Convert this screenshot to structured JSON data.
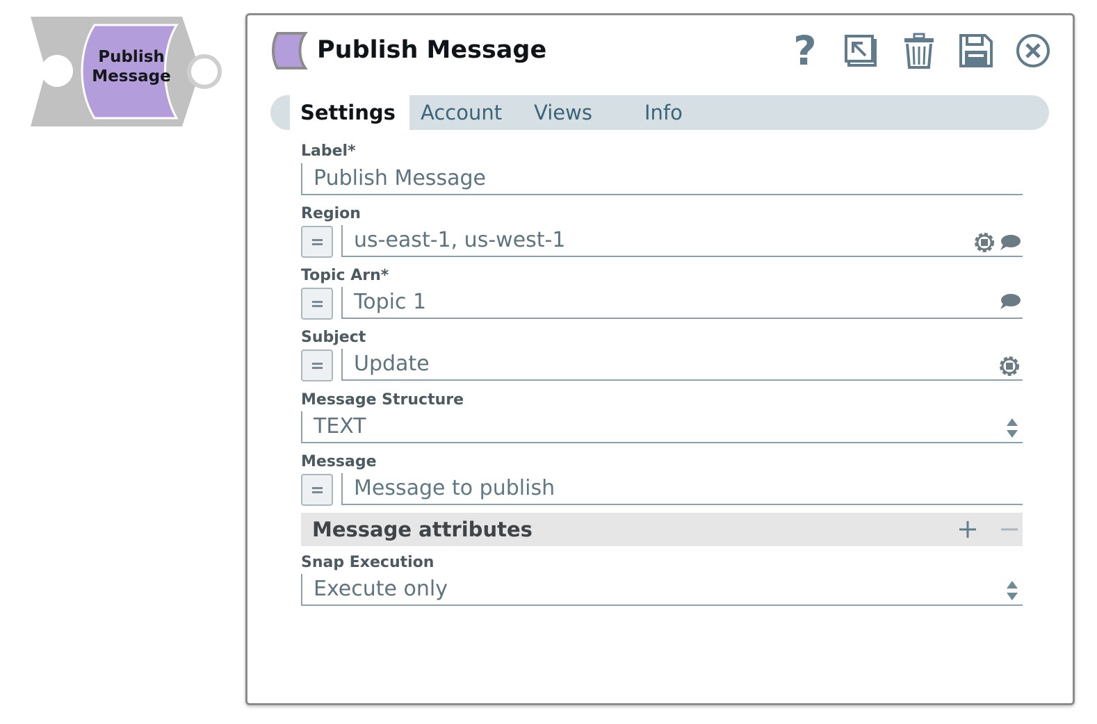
{
  "snap_node": {
    "label": "Publish\nMessage"
  },
  "dialog": {
    "title": "Publish Message",
    "toolbar": {
      "help_glyph": "?",
      "help_icon": "help-icon",
      "export_icon": "export-icon",
      "delete_icon": "trash-icon",
      "save_icon": "save-icon",
      "close_icon": "close-circle-icon"
    },
    "tabs": [
      {
        "label": "Settings",
        "active": true
      },
      {
        "label": "Account",
        "active": false
      },
      {
        "label": "Views",
        "active": false
      },
      {
        "label": "Info",
        "active": false
      }
    ],
    "fields": {
      "label": {
        "label": "Label*",
        "value": "Publish Message"
      },
      "region": {
        "label": "Region",
        "value": "us-east-1, us-west-1"
      },
      "topic_arn": {
        "label": "Topic Arn*",
        "value": "Topic 1"
      },
      "subject": {
        "label": "Subject",
        "value": "Update"
      },
      "message_structure": {
        "label": "Message Structure",
        "value": "TEXT"
      },
      "message": {
        "label": "Message",
        "placeholder": "Message to publish"
      },
      "snap_execution": {
        "label": "Snap Execution",
        "value": "Execute only"
      }
    },
    "message_attributes": {
      "title": "Message attributes",
      "add_glyph": "+",
      "remove_glyph": "−"
    }
  },
  "colors": {
    "snap_body": "#c1c1c1",
    "snap_accent": "#b39ddb",
    "icon_blue_gray": "#607c8c",
    "tab_bar": "#d6dfe3",
    "section_bar": "#e6e6e6"
  }
}
